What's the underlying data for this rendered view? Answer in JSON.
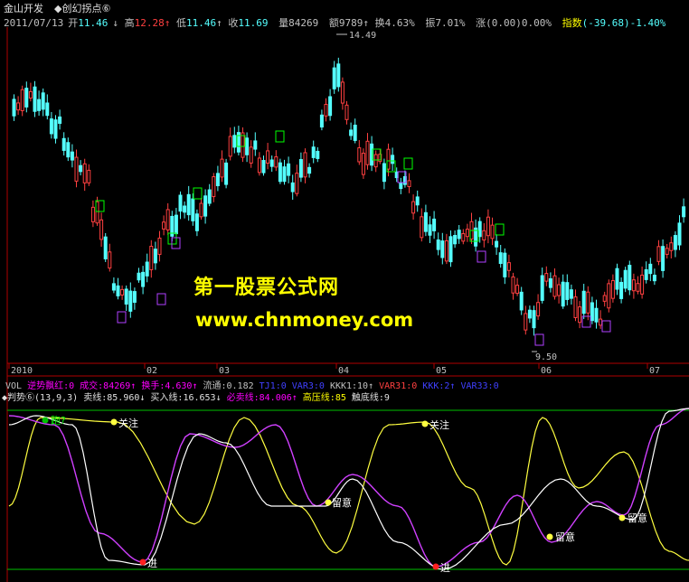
{
  "window": {
    "tabs": [
      "金山开发",
      "◆创幻拐点⑥"
    ]
  },
  "ohlc": {
    "date": "2011/07/13",
    "open_label": "开",
    "open": "11.46",
    "high_label": "高",
    "high": "12.28",
    "low_label": "低",
    "low": "11.46",
    "close_label": "收",
    "close": "11.69",
    "vol_label": "量",
    "vol": "84269",
    "amt_label": "额",
    "amt": "9789",
    "turn_label": "换",
    "turn": "4.63%",
    "amp_label": "振",
    "amp": "7.01%",
    "chg_label": "涨",
    "chg": "(0.00)0.00%",
    "idx_label": "指数",
    "idx": "(-39.68)-1.40%"
  },
  "price_chart": {
    "high_marker": "14.49",
    "low_marker": "9.50",
    "date_axis": [
      "2010",
      "02",
      "03",
      "04",
      "05",
      "06",
      "07"
    ]
  },
  "watermark": {
    "line1": "第一股票公式网",
    "line2": "www.chnmoney.com"
  },
  "vol_bar": {
    "label": "VOL",
    "items": [
      {
        "text": "逆势飘红:0",
        "color": "#ff00ff"
      },
      {
        "text": "成交:84269↑",
        "color": "#ff00ff"
      },
      {
        "text": "换手:4.630↑",
        "color": "#ff00ff"
      },
      {
        "text": "流通:0.182",
        "color": "#c0c0c0"
      },
      {
        "text": "TJ1:0",
        "color": "#4040ff"
      },
      {
        "text": "VAR3:0",
        "color": "#4040ff"
      },
      {
        "text": "KKK1:10↑",
        "color": "#c0c0c0"
      },
      {
        "text": "VAR31:0",
        "color": "#ff4040"
      },
      {
        "text": "KKK:2↑",
        "color": "#4040ff"
      },
      {
        "text": "VAR33:0",
        "color": "#4040ff"
      }
    ]
  },
  "judge_bar": {
    "label": "◆判势⑥",
    "params": "(13,9,3)",
    "items": [
      {
        "text": "卖线:85.960↓",
        "color": "#e0e0e0"
      },
      {
        "text": "买入线:16.653↓",
        "color": "#e0e0e0"
      },
      {
        "text": "必卖线:84.006↑",
        "color": "#ff00ff"
      },
      {
        "text": "高压线:85",
        "color": "#ffff00"
      },
      {
        "text": "触底线:9",
        "color": "#e0e0e0"
      }
    ]
  },
  "osc_labels": {
    "run": "跑?",
    "focus1": "关注",
    "focus2": "关注",
    "enter1": "进",
    "enter2": "进",
    "watch1": "留意",
    "watch2": "留意",
    "watch3": "留意"
  },
  "colors": {
    "up": "#ff4040",
    "down": "#54ffff",
    "box_green": "#00ff00",
    "box_purple": "#b040ff",
    "yellow_line": "#ffff40",
    "magenta_line": "#d040ff",
    "white_line": "#ffffff"
  }
}
